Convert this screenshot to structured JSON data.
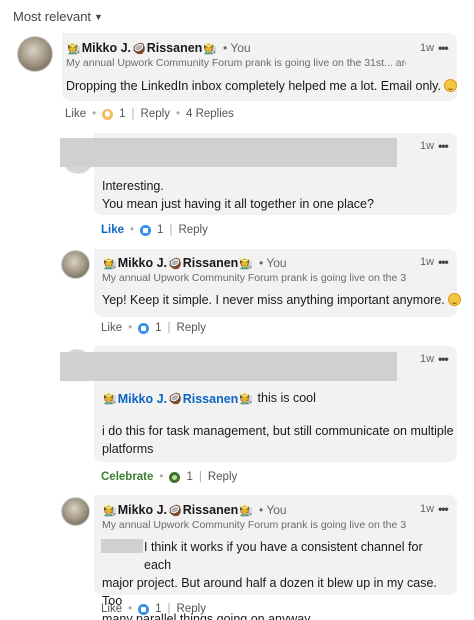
{
  "sort": {
    "label": "Most relevant",
    "icon": "caret-down-icon"
  },
  "comments": [
    {
      "author": "Mikko J.",
      "author_last": "Rissanen",
      "you": "• You",
      "headline": "My annual Upwork Community Forum prank is going live on the 31st... are...",
      "time": "1w",
      "text": "Dropping the LinkedIn inbox completely helped me a lot. Email only.",
      "action_primary": "Like",
      "reaction_count": "1",
      "reply": "Reply",
      "replies": "4 Replies"
    },
    {
      "text_l1": "Interesting.",
      "text_l2": "You mean just having it all together in one place?",
      "time": "1w",
      "action_primary": "Like",
      "reaction_count": "1",
      "reply": "Reply"
    },
    {
      "author": "Mikko J.",
      "author_last": "Rissanen",
      "you": "• You",
      "headline": "My annual Upwork Community Forum prank is going live on the 3...",
      "time": "1w",
      "text": "Yep! Keep it simple. I never miss anything important anymore.",
      "action_primary": "Like",
      "reaction_count": "1",
      "reply": "Reply"
    },
    {
      "mention_first": "Mikko J.",
      "mention_last": "Rissanen",
      "mention_after": "this is cool",
      "text_l1": "i do this for task management, but still communicate on multiple",
      "text_l2": "platforms",
      "time": "1w",
      "action_primary": "Celebrate",
      "reaction_count": "1",
      "reply": "Reply"
    },
    {
      "author": "Mikko J.",
      "author_last": "Rissanen",
      "you": "• You",
      "headline": "My annual Upwork Community Forum prank is going live on the 3...",
      "time": "1w",
      "text_l1": "I think it works if you have a consistent channel for each",
      "text_l2": "major project. But around half a dozen it blew up in my case. Too",
      "text_l3": "many parallel things going on anyway.",
      "action_primary": "Like",
      "reaction_count": "1",
      "reply": "Reply"
    }
  ],
  "emoji": {
    "left": "🧑‍🌾",
    "coconut": "🥥"
  },
  "colors": {
    "link": "#0a66c2",
    "bubble": "#f2f2f2",
    "celebrate": "#3a7d2c"
  }
}
